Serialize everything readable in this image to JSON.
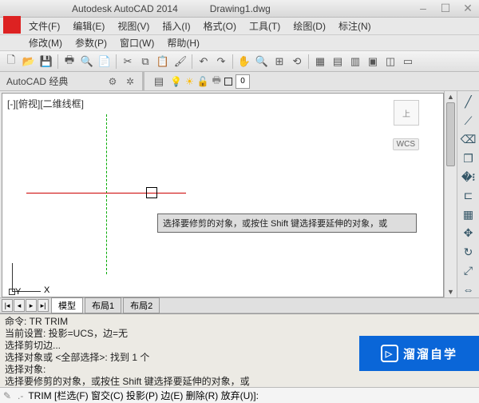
{
  "title": {
    "app": "Autodesk AutoCAD 2014",
    "doc": "Drawing1.dwg"
  },
  "win": {
    "min": "–",
    "max": "☐",
    "close": "✕"
  },
  "menu1": [
    {
      "l": "文件(F)"
    },
    {
      "l": "编辑(E)"
    },
    {
      "l": "视图(V)"
    },
    {
      "l": "插入(I)"
    },
    {
      "l": "格式(O)"
    },
    {
      "l": "工具(T)"
    },
    {
      "l": "绘图(D)"
    },
    {
      "l": "标注(N)"
    }
  ],
  "menu2": [
    {
      "l": "修改(M)"
    },
    {
      "l": "参数(P)"
    },
    {
      "l": "窗口(W)"
    },
    {
      "l": "帮助(H)"
    }
  ],
  "workspace": {
    "label": "AutoCAD 经典",
    "layer_zero": "0"
  },
  "canvas": {
    "title": "[-][俯视][二维线框]",
    "viewcube": "上",
    "wcs": "WCS",
    "tooltip": "选择要修剪的对象，或按住 Shift 键选择要延伸的对象，或",
    "ucs": {
      "x": "X",
      "y": "Y"
    }
  },
  "tabs": {
    "nav": [
      "|◂",
      "◂",
      "▸",
      "▸|"
    ],
    "items": [
      {
        "l": "模型",
        "active": true
      },
      {
        "l": "布局1",
        "active": false
      },
      {
        "l": "布局2",
        "active": false
      }
    ]
  },
  "cmd": {
    "lines": [
      "命令: TR TRIM",
      "当前设置: 投影=UCS，边=无",
      "选择剪切边...",
      "选择对象或 <全部选择>: 找到 1 个",
      "选择对象:",
      "选择要修剪的对象，或按住 Shift 键选择要延伸的对象，或"
    ],
    "prompt": "TRIM [栏选(F) 窗交(C) 投影(P) 边(E) 删除(R) 放弃(U)]:"
  },
  "watermark": {
    "text": "溜溜自学"
  }
}
